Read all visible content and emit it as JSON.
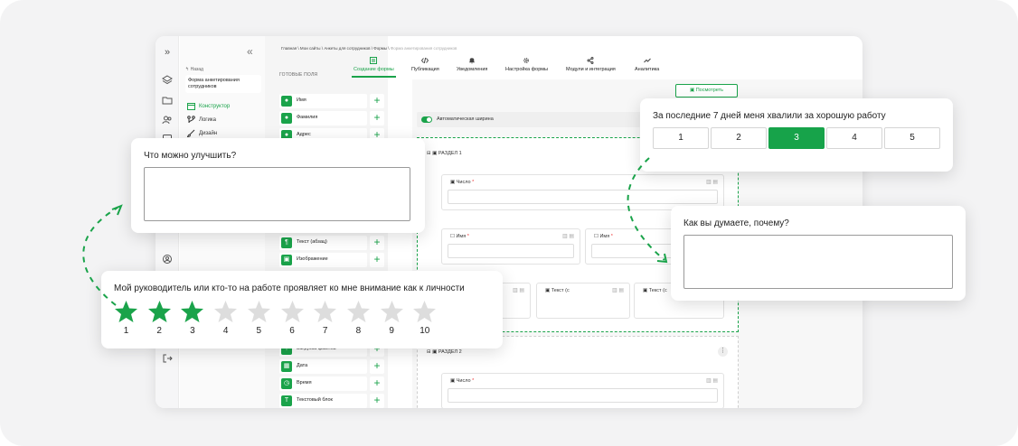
{
  "breadcrumb": [
    "Главная",
    "Мои сайты",
    "Анкеты для сотрудников",
    "Формы",
    "Форма анкетирования сотрудников"
  ],
  "nav": {
    "back": "Назад",
    "form_name": "Форма анкетирования сотрудников",
    "items": [
      {
        "label": "Конструктор",
        "icon": "calendar-icon",
        "active": true
      },
      {
        "label": "Логика",
        "icon": "branch-icon",
        "active": false
      },
      {
        "label": "Дизайн",
        "icon": "brush-icon",
        "active": false
      }
    ]
  },
  "tabs": [
    {
      "label": "Создание формы",
      "icon": "form-icon",
      "active": true
    },
    {
      "label": "Публикация",
      "icon": "code-icon",
      "active": false
    },
    {
      "label": "Уведомления",
      "icon": "bell-icon",
      "active": false
    },
    {
      "label": "Настройка формы",
      "icon": "gear-icon",
      "active": false
    },
    {
      "label": "Модули и интеграция",
      "icon": "share-icon",
      "active": false
    },
    {
      "label": "Аналитика",
      "icon": "chart-icon",
      "active": false
    }
  ],
  "fields_panel": {
    "title": "ГОТОВЫЕ ПОЛЯ",
    "top": [
      {
        "label": "Имя",
        "icon": "person-icon"
      },
      {
        "label": "Фамилия",
        "icon": "person-icon"
      },
      {
        "label": "Адрес",
        "icon": "pin-icon"
      }
    ],
    "middle": [
      {
        "label": "Текст (абзац)",
        "icon": "paragraph-icon"
      },
      {
        "label": "Изображение",
        "icon": "image-icon"
      }
    ],
    "bottom": [
      {
        "label": "Загрузка файлов",
        "icon": "upload-icon"
      },
      {
        "label": "Дата",
        "icon": "date-icon"
      },
      {
        "label": "Время",
        "icon": "clock-icon"
      },
      {
        "label": "Текстовый блок",
        "icon": "textblock-icon"
      }
    ]
  },
  "preview_button": "Посмотреть",
  "auto_width_label": "Автоматическая ширина",
  "sections": [
    {
      "title": "РАЗДЕЛ 1",
      "fields": [
        "Число",
        "Имя",
        "Имя",
        "Текст (с",
        "Текст (с"
      ]
    },
    {
      "title": "РАЗДЕЛ 2",
      "fields": [
        "Число"
      ]
    }
  ],
  "cards": {
    "improve": {
      "question": "Что можно улучшить?"
    },
    "week": {
      "question": "За последние 7 дней меня хвалили за хорошую работу",
      "options": [
        "1",
        "2",
        "3",
        "4",
        "5"
      ],
      "selected": "3"
    },
    "why": {
      "question": "Как вы думаете, почему?"
    },
    "manager": {
      "question": "Мой руководитель или кто-то на работе проявляет ко мне внимание как к личности",
      "stars": [
        "1",
        "2",
        "3",
        "4",
        "5",
        "6",
        "7",
        "8",
        "9",
        "10"
      ],
      "rating": 3
    }
  },
  "colors": {
    "accent": "#1aa34a",
    "star_off": "#dddddd"
  }
}
